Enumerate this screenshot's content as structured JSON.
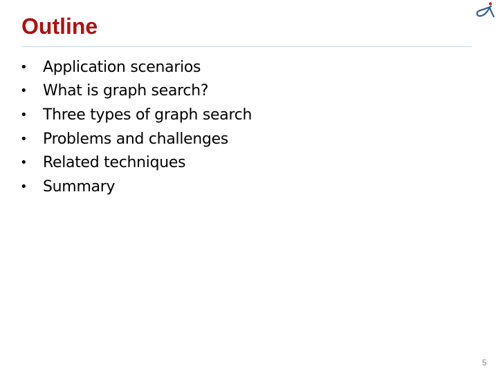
{
  "slide": {
    "title": "Outline",
    "bullet_glyph": "•",
    "items": [
      {
        "label": "Application scenarios"
      },
      {
        "label": "What is graph search?"
      },
      {
        "label": "Three types of graph search"
      },
      {
        "label": "Problems and challenges"
      },
      {
        "label": "Related techniques"
      },
      {
        "label": "Summary"
      }
    ],
    "page_number": "5",
    "logo_icon": "swoosh-logo-icon",
    "colors": {
      "title": "#b01010",
      "divider": "#c6d6e2",
      "logo_blue": "#2f5f9a",
      "logo_red": "#d0202a"
    }
  }
}
